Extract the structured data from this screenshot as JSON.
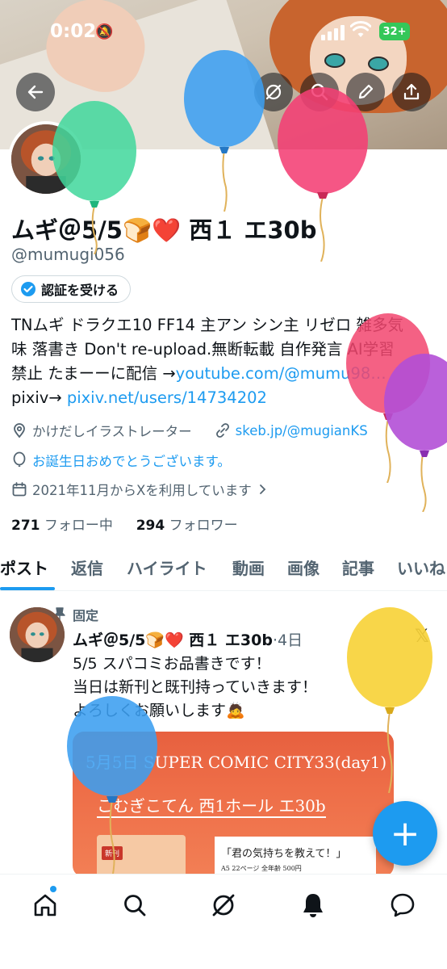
{
  "status_bar": {
    "time": "0:02",
    "battery": "32+"
  },
  "profile": {
    "name": "ムギ＠5/5🍞❤️ 西１ エ30b",
    "handle": "@mumugi056",
    "verify_label": "認証を受ける",
    "bio_line1": "TNムギ ドラクエ10 FF14 主アン シン主 リゼロ 雑多気",
    "bio_line2": "味 落書き Don't re-upload.無断転載 自作発言 AI学習",
    "bio_line3_prefix": "禁止 たまーーに配信 →",
    "bio_link_youtube": "youtube.com/@mumu98…",
    "bio_line4_prefix": "pixiv→ ",
    "bio_link_pixiv": "pixiv.net/users/14734202",
    "profession": "かけだしイラストレーター",
    "website": "skeb.jp/@mugianKS",
    "birthday": "お誕生日おめでとうございます。",
    "joined": "2021年11月からXを利用しています",
    "following_count": "271",
    "following_label": "フォロー中",
    "followers_count": "294",
    "followers_label": "フォロワー"
  },
  "tabs": [
    "ポスト",
    "返信",
    "ハイライト",
    "動画",
    "画像",
    "記事",
    "いいね"
  ],
  "pinned_post": {
    "pinned_label": "固定",
    "author": "ムギ＠5/5🍞❤️ 西１ エ30b",
    "date": "·4日",
    "line1": "5/5 スパコミお品書きです！",
    "line2": "当日は新刊と既刊持っていきます！",
    "line3": "よろしくお願いします🙇",
    "image_line1": "5月5日 SUPER COMIC CITY33(day1)",
    "image_line2": "こむぎこてん 西1ホール エ30b",
    "image_card_title": "「君の気持ちを教えて！」",
    "image_card_sub": "A5  22ページ  全年齢  500円",
    "image_badge": "新刊"
  },
  "fab_label": "+",
  "colors": {
    "accent": "#1d9bf0",
    "text": "#0f1419",
    "muted": "#536471"
  },
  "icons": [
    "back-arrow-icon",
    "grok-icon",
    "search-icon",
    "edit-icon",
    "share-icon",
    "verified-icon",
    "location-icon",
    "link-icon",
    "balloon-icon",
    "calendar-icon",
    "pin-icon",
    "x-logo-icon",
    "home-icon",
    "grok-icon",
    "bell-icon",
    "message-icon"
  ]
}
